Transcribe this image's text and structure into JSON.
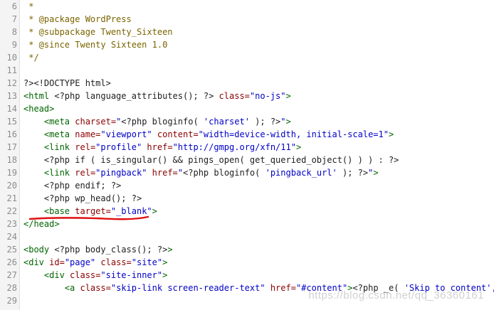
{
  "editor": {
    "lines": [
      {
        "n": "6",
        "tokens": [
          {
            "t": "comment",
            "v": " *"
          }
        ]
      },
      {
        "n": "7",
        "tokens": [
          {
            "t": "comment",
            "v": " * @package WordPress"
          }
        ]
      },
      {
        "n": "8",
        "tokens": [
          {
            "t": "comment",
            "v": " * @subpackage Twenty_Sixteen"
          }
        ]
      },
      {
        "n": "9",
        "tokens": [
          {
            "t": "comment",
            "v": " * @since Twenty Sixteen 1.0"
          }
        ]
      },
      {
        "n": "10",
        "tokens": [
          {
            "t": "comment",
            "v": " */"
          }
        ]
      },
      {
        "n": "11",
        "tokens": []
      },
      {
        "n": "12",
        "tokens": [
          {
            "t": "plain",
            "v": "?><!DOCTYPE html>"
          }
        ]
      },
      {
        "n": "13",
        "tokens": [
          {
            "t": "tag",
            "v": "<html "
          },
          {
            "t": "php",
            "v": "<?php language_attributes(); ?> "
          },
          {
            "t": "attr",
            "v": "class="
          },
          {
            "t": "str",
            "v": "\"no-js\""
          },
          {
            "t": "tag",
            "v": ">"
          }
        ]
      },
      {
        "n": "14",
        "tokens": [
          {
            "t": "tag",
            "v": "<head>"
          }
        ]
      },
      {
        "n": "15",
        "tokens": [
          {
            "t": "plain",
            "v": "    "
          },
          {
            "t": "tag",
            "v": "<meta "
          },
          {
            "t": "attr",
            "v": "charset="
          },
          {
            "t": "str",
            "v": "\""
          },
          {
            "t": "php",
            "v": "<?php bloginfo( "
          },
          {
            "t": "str",
            "v": "'charset'"
          },
          {
            "t": "php",
            "v": " ); ?>"
          },
          {
            "t": "str",
            "v": "\""
          },
          {
            "t": "tag",
            "v": ">"
          }
        ]
      },
      {
        "n": "16",
        "tokens": [
          {
            "t": "plain",
            "v": "    "
          },
          {
            "t": "tag",
            "v": "<meta "
          },
          {
            "t": "attr",
            "v": "name="
          },
          {
            "t": "str",
            "v": "\"viewport\""
          },
          {
            "t": "attr",
            "v": " content="
          },
          {
            "t": "str",
            "v": "\"width=device-width, initial-scale=1\""
          },
          {
            "t": "tag",
            "v": ">"
          }
        ]
      },
      {
        "n": "17",
        "tokens": [
          {
            "t": "plain",
            "v": "    "
          },
          {
            "t": "tag",
            "v": "<link "
          },
          {
            "t": "attr",
            "v": "rel="
          },
          {
            "t": "str",
            "v": "\"profile\""
          },
          {
            "t": "attr",
            "v": " href="
          },
          {
            "t": "str",
            "v": "\"http://gmpg.org/xfn/11\""
          },
          {
            "t": "tag",
            "v": ">"
          }
        ]
      },
      {
        "n": "18",
        "tokens": [
          {
            "t": "plain",
            "v": "    "
          },
          {
            "t": "php",
            "v": "<?php if ( is_singular() && pings_open( get_queried_object() ) ) : ?>"
          }
        ]
      },
      {
        "n": "19",
        "tokens": [
          {
            "t": "plain",
            "v": "    "
          },
          {
            "t": "tag",
            "v": "<link "
          },
          {
            "t": "attr",
            "v": "rel="
          },
          {
            "t": "str",
            "v": "\"pingback\""
          },
          {
            "t": "attr",
            "v": " href="
          },
          {
            "t": "str",
            "v": "\""
          },
          {
            "t": "php",
            "v": "<?php bloginfo( "
          },
          {
            "t": "str",
            "v": "'pingback_url'"
          },
          {
            "t": "php",
            "v": " ); ?>"
          },
          {
            "t": "str",
            "v": "\""
          },
          {
            "t": "tag",
            "v": ">"
          }
        ]
      },
      {
        "n": "20",
        "tokens": [
          {
            "t": "plain",
            "v": "    "
          },
          {
            "t": "php",
            "v": "<?php endif; ?>"
          }
        ]
      },
      {
        "n": "21",
        "tokens": [
          {
            "t": "plain",
            "v": "    "
          },
          {
            "t": "php",
            "v": "<?php wp_head(); ?>"
          }
        ]
      },
      {
        "n": "22",
        "tokens": [
          {
            "t": "plain",
            "v": "    "
          },
          {
            "t": "tag",
            "v": "<base "
          },
          {
            "t": "attr",
            "v": "target="
          },
          {
            "t": "str",
            "v": "\"_blank\""
          },
          {
            "t": "tag",
            "v": ">"
          }
        ]
      },
      {
        "n": "23",
        "tokens": [
          {
            "t": "tag",
            "v": "</head>"
          }
        ]
      },
      {
        "n": "24",
        "tokens": []
      },
      {
        "n": "25",
        "tokens": [
          {
            "t": "tag",
            "v": "<body "
          },
          {
            "t": "php",
            "v": "<?php body_class(); ?>"
          },
          {
            "t": "tag",
            "v": ">"
          }
        ]
      },
      {
        "n": "26",
        "tokens": [
          {
            "t": "tag",
            "v": "<div "
          },
          {
            "t": "attr",
            "v": "id="
          },
          {
            "t": "str",
            "v": "\"page\""
          },
          {
            "t": "attr",
            "v": " class="
          },
          {
            "t": "str",
            "v": "\"site\""
          },
          {
            "t": "tag",
            "v": ">"
          }
        ]
      },
      {
        "n": "27",
        "tokens": [
          {
            "t": "plain",
            "v": "    "
          },
          {
            "t": "tag",
            "v": "<div "
          },
          {
            "t": "attr",
            "v": "class="
          },
          {
            "t": "str",
            "v": "\"site-inner\""
          },
          {
            "t": "tag",
            "v": ">"
          }
        ]
      },
      {
        "n": "28",
        "tokens": [
          {
            "t": "plain",
            "v": "        "
          },
          {
            "t": "tag",
            "v": "<a "
          },
          {
            "t": "attr",
            "v": "class="
          },
          {
            "t": "str",
            "v": "\"skip-link screen-reader-text\""
          },
          {
            "t": "attr",
            "v": " href="
          },
          {
            "t": "str",
            "v": "\"#content\""
          },
          {
            "t": "tag",
            "v": ">"
          },
          {
            "t": "php",
            "v": "<?php _e( "
          },
          {
            "t": "str",
            "v": "'Skip to content', 'twentysi"
          }
        ]
      },
      {
        "n": "29",
        "tokens": []
      }
    ],
    "highlighted_line": "22",
    "annotation_color": "#e01010"
  },
  "watermark": "https://blog.csdn.net/qq_36360161"
}
